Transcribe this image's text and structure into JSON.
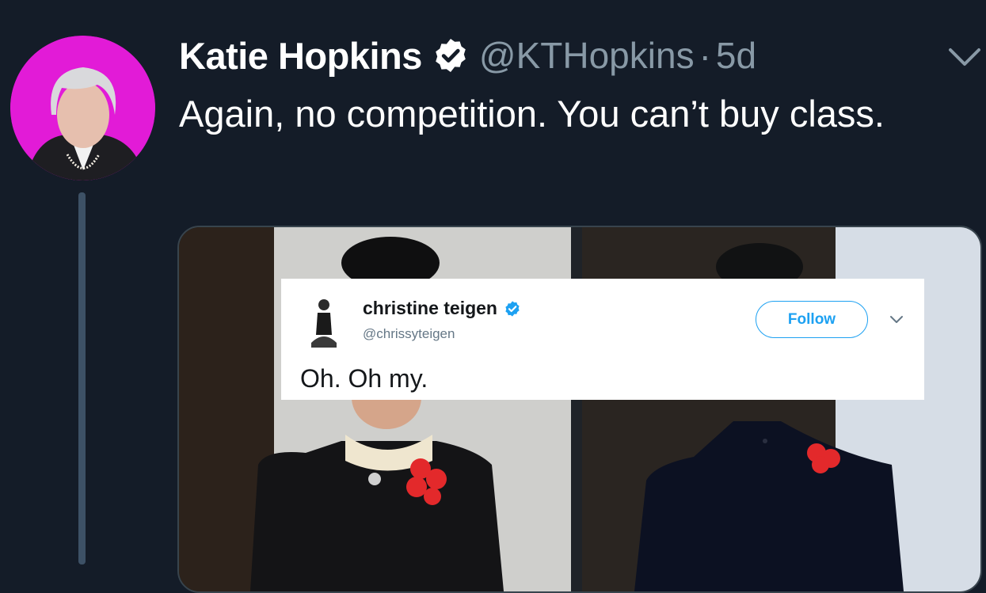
{
  "tweet": {
    "display_name": "Katie Hopkins",
    "handle": "@KTHopkins",
    "separator": "·",
    "time": "5d",
    "text": "Again, no competition. You can’t buy class.",
    "avatar_icon": "profile-photo",
    "verified_icon": "verified-badge",
    "menu_icon": "chevron-down-icon"
  },
  "embedded_tweet": {
    "display_name": "christine teigen",
    "handle": "@chrissyteigen",
    "follow_label": "Follow",
    "text": "Oh. Oh my.",
    "verified_icon": "verified-badge",
    "menu_icon": "chevron-down-icon"
  },
  "colors": {
    "background": "#141c28",
    "text_primary": "#ffffff",
    "text_secondary": "#8899a6",
    "avatar_ring": "#e21bd7",
    "accent_blue": "#1da1f2",
    "poppy_red": "#e3292b"
  }
}
